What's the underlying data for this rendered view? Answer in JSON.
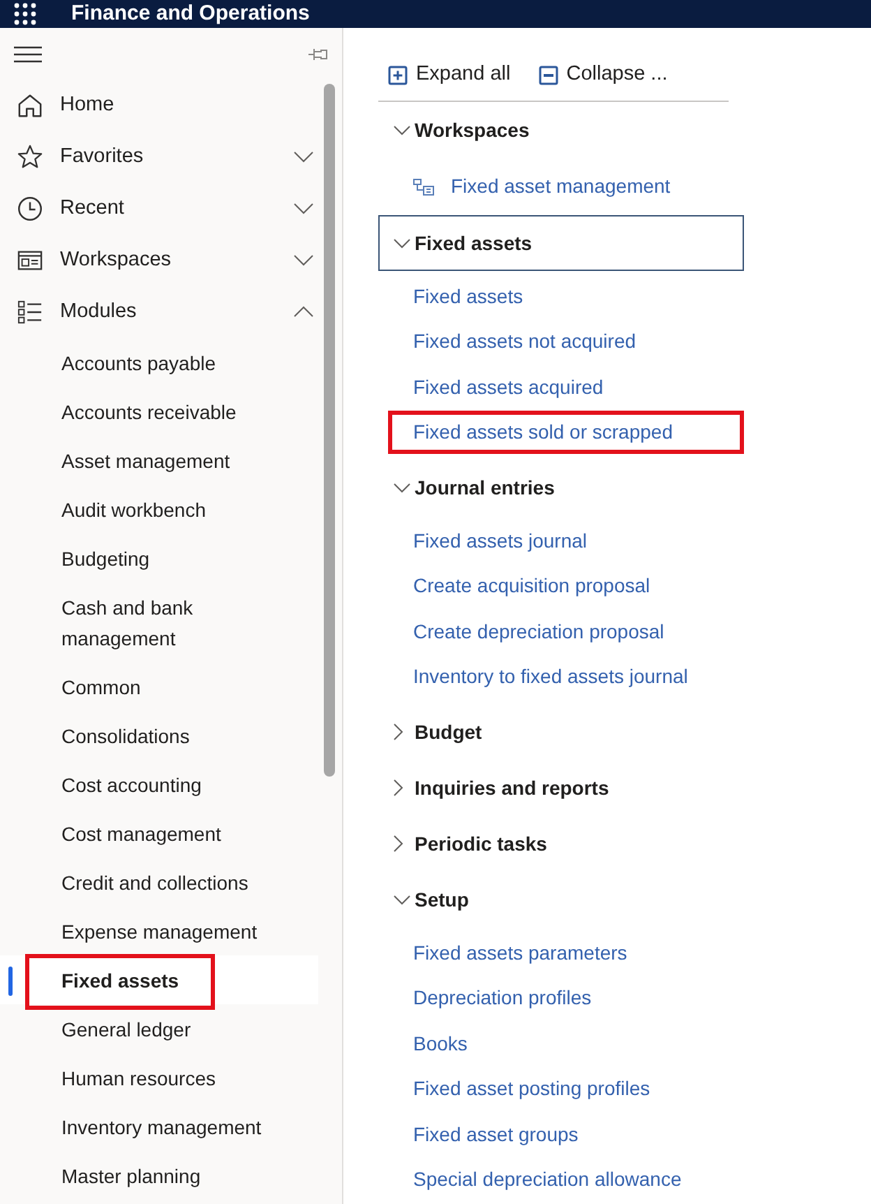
{
  "header": {
    "title": "Finance and Operations"
  },
  "nav": {
    "items": [
      {
        "label": "Home",
        "kind": "link"
      },
      {
        "label": "Favorites",
        "kind": "group",
        "expanded": false
      },
      {
        "label": "Recent",
        "kind": "group",
        "expanded": false
      },
      {
        "label": "Workspaces",
        "kind": "group",
        "expanded": false
      },
      {
        "label": "Modules",
        "kind": "group",
        "expanded": true,
        "children": [
          {
            "label": "Accounts payable",
            "selected": false,
            "highlighted": false
          },
          {
            "label": "Accounts receivable",
            "selected": false,
            "highlighted": false
          },
          {
            "label": "Asset management",
            "selected": false,
            "highlighted": false
          },
          {
            "label": "Audit workbench",
            "selected": false,
            "highlighted": false
          },
          {
            "label": "Budgeting",
            "selected": false,
            "highlighted": false
          },
          {
            "label": "Cash and bank management",
            "selected": false,
            "highlighted": false
          },
          {
            "label": "Common",
            "selected": false,
            "highlighted": false
          },
          {
            "label": "Consolidations",
            "selected": false,
            "highlighted": false
          },
          {
            "label": "Cost accounting",
            "selected": false,
            "highlighted": false
          },
          {
            "label": "Cost management",
            "selected": false,
            "highlighted": false
          },
          {
            "label": "Credit and collections",
            "selected": false,
            "highlighted": false
          },
          {
            "label": "Expense management",
            "selected": false,
            "highlighted": false
          },
          {
            "label": "Fixed assets",
            "selected": true,
            "highlighted": true
          },
          {
            "label": "General ledger",
            "selected": false,
            "highlighted": false
          },
          {
            "label": "Human resources",
            "selected": false,
            "highlighted": false
          },
          {
            "label": "Inventory management",
            "selected": false,
            "highlighted": false
          },
          {
            "label": "Master planning",
            "selected": false,
            "highlighted": false
          }
        ]
      }
    ]
  },
  "toolbar": {
    "buttons": [
      {
        "label": "Expand all",
        "kind": "expand"
      },
      {
        "label": "Collapse ...",
        "kind": "collapse"
      }
    ]
  },
  "sections": [
    {
      "title": "Workspaces",
      "expanded": true,
      "focused": false,
      "links": [
        {
          "label": "Fixed asset management",
          "kind": "workspace",
          "highlighted": false
        }
      ]
    },
    {
      "title": "Fixed assets",
      "expanded": true,
      "focused": true,
      "links": [
        {
          "label": "Fixed assets",
          "kind": "page",
          "highlighted": false
        },
        {
          "label": "Fixed assets not acquired",
          "kind": "page",
          "highlighted": false
        },
        {
          "label": "Fixed assets acquired",
          "kind": "page",
          "highlighted": false
        },
        {
          "label": "Fixed assets sold or scrapped",
          "kind": "page",
          "highlighted": true
        }
      ]
    },
    {
      "title": "Journal entries",
      "expanded": true,
      "focused": false,
      "links": [
        {
          "label": "Fixed assets journal",
          "kind": "page",
          "highlighted": false
        },
        {
          "label": "Create acquisition proposal",
          "kind": "page",
          "highlighted": false
        },
        {
          "label": "Create depreciation proposal",
          "kind": "page",
          "highlighted": false
        },
        {
          "label": "Inventory to fixed assets journal",
          "kind": "page",
          "highlighted": false
        }
      ]
    },
    {
      "title": "Budget",
      "expanded": false,
      "focused": false
    },
    {
      "title": "Inquiries and reports",
      "expanded": false,
      "focused": false
    },
    {
      "title": "Periodic tasks",
      "expanded": false,
      "focused": false
    },
    {
      "title": "Setup",
      "expanded": true,
      "focused": false,
      "links": [
        {
          "label": "Fixed assets parameters",
          "kind": "page",
          "highlighted": false
        },
        {
          "label": "Depreciation profiles",
          "kind": "page",
          "highlighted": false
        },
        {
          "label": "Books",
          "kind": "page",
          "highlighted": false
        },
        {
          "label": "Fixed asset posting profiles",
          "kind": "page",
          "highlighted": false
        },
        {
          "label": "Fixed asset groups",
          "kind": "page",
          "highlighted": false
        },
        {
          "label": "Special depreciation allowance",
          "kind": "page",
          "highlighted": false
        }
      ]
    }
  ]
}
